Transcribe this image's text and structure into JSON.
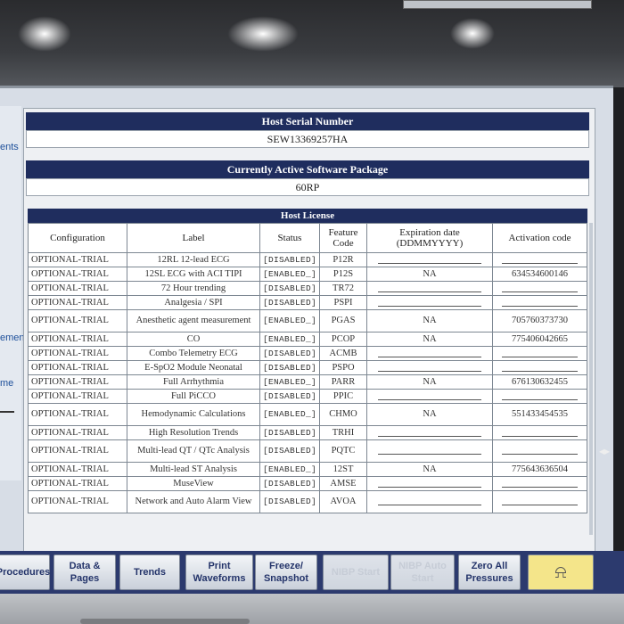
{
  "colors": {
    "header_navy": "#1f2d5e",
    "screen_bg": "#d7dde6",
    "alarm_button": "#f4e58a",
    "button_text": "#24346a"
  },
  "left_fragments": [
    "ents",
    "ement",
    "me"
  ],
  "host_serial": {
    "title": "Host Serial Number",
    "value": "SEW13369257HA"
  },
  "software_package": {
    "title": "Currently Active Software Package",
    "value": "60RP"
  },
  "license": {
    "title": "Host License",
    "headers": {
      "config": "Configuration",
      "label": "Label",
      "status": "Status",
      "feature": "Feature Code",
      "expiration": "Expiration date (DDMMYYYY)",
      "activation": "Activation code"
    },
    "rows": [
      {
        "config": "OPTIONAL-TRIAL",
        "label": "12RL 12-lead ECG",
        "status": "[DISABLED]",
        "feature": "P12R",
        "expiration": "",
        "activation": ""
      },
      {
        "config": "OPTIONAL-TRIAL",
        "label": "12SL ECG with ACI TIPI",
        "status": "[ENABLED_]",
        "feature": "P12S",
        "expiration": "NA",
        "activation": "634534600146"
      },
      {
        "config": "OPTIONAL-TRIAL",
        "label": "72 Hour trending",
        "status": "[DISABLED]",
        "feature": "TR72",
        "expiration": "",
        "activation": ""
      },
      {
        "config": "OPTIONAL-TRIAL",
        "label": "Analgesia / SPI",
        "status": "[DISABLED]",
        "feature": "PSPI",
        "expiration": "",
        "activation": ""
      },
      {
        "config": "OPTIONAL-TRIAL",
        "label": "Anesthetic agent measurement",
        "status": "[ENABLED_]",
        "feature": "PGAS",
        "expiration": "NA",
        "activation": "705760373730"
      },
      {
        "config": "OPTIONAL-TRIAL",
        "label": "CO",
        "status": "[ENABLED_]",
        "feature": "PCOP",
        "expiration": "NA",
        "activation": "775406042665"
      },
      {
        "config": "OPTIONAL-TRIAL",
        "label": "Combo Telemetry ECG",
        "status": "[DISABLED]",
        "feature": "ACMB",
        "expiration": "",
        "activation": ""
      },
      {
        "config": "OPTIONAL-TRIAL",
        "label": "E-SpO2 Module Neonatal",
        "status": "[DISABLED]",
        "feature": "PSPO",
        "expiration": "",
        "activation": ""
      },
      {
        "config": "OPTIONAL-TRIAL",
        "label": "Full Arrhythmia",
        "status": "[ENABLED_]",
        "feature": "PARR",
        "expiration": "NA",
        "activation": "676130632455"
      },
      {
        "config": "OPTIONAL-TRIAL",
        "label": "Full PiCCO",
        "status": "[DISABLED]",
        "feature": "PPIC",
        "expiration": "",
        "activation": ""
      },
      {
        "config": "OPTIONAL-TRIAL",
        "label": "Hemodynamic Calculations",
        "status": "[ENABLED_]",
        "feature": "CHMO",
        "expiration": "NA",
        "activation": "551433454535"
      },
      {
        "config": "OPTIONAL-TRIAL",
        "label": "High Resolution Trends",
        "status": "[DISABLED]",
        "feature": "TRHI",
        "expiration": "",
        "activation": ""
      },
      {
        "config": "OPTIONAL-TRIAL",
        "label": "Multi-lead QT / QTc Analysis",
        "status": "[DISABLED]",
        "feature": "PQTC",
        "expiration": "",
        "activation": ""
      },
      {
        "config": "OPTIONAL-TRIAL",
        "label": "Multi-lead ST Analysis",
        "status": "[ENABLED_]",
        "feature": "12ST",
        "expiration": "NA",
        "activation": "775643636504"
      },
      {
        "config": "OPTIONAL-TRIAL",
        "label": "MuseView",
        "status": "[DISABLED]",
        "feature": "AMSE",
        "expiration": "",
        "activation": ""
      },
      {
        "config": "OPTIONAL-TRIAL",
        "label": "Network and Auto Alarm View",
        "status": "[DISABLED]",
        "feature": "AVOA",
        "expiration": "",
        "activation": ""
      }
    ]
  },
  "buttons": [
    {
      "label": "Procedures",
      "state": "normal"
    },
    {
      "label": "Data & Pages",
      "state": "normal"
    },
    {
      "label": "Trends",
      "state": "normal"
    },
    {
      "label": "Print Waveforms",
      "state": "normal"
    },
    {
      "label": "Freeze/ Snapshot",
      "state": "normal"
    },
    {
      "label": "NIBP Start",
      "state": "disabled"
    },
    {
      "label": "NIBP Auto Start",
      "state": "disabled"
    },
    {
      "label": "Zero All Pressures",
      "state": "normal"
    },
    {
      "label": "bell-alarm-icon",
      "state": "alarm"
    }
  ]
}
